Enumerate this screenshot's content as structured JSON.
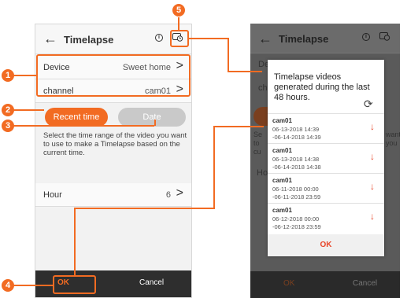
{
  "left_screen": {
    "title": "Timelapse",
    "back_icon": "←",
    "info_icon": "i",
    "device_label": "Device",
    "device_value": "Sweet home",
    "channel_label": "channel",
    "channel_value": "cam01",
    "chevron": ">",
    "recent_time_button": "Recent time",
    "date_button": "Date",
    "description": "Select the time range of the video you want to use to make a Timelapse based on the current time.",
    "hour_label": "Hour",
    "hour_value": "6",
    "ok_label": "OK",
    "cancel_label": "Cancel"
  },
  "right_screen": {
    "title": "Timelapse",
    "back_icon": "←",
    "info_icon": "i",
    "ghost_labels": [
      "De",
      "ch",
      "Se",
      "to",
      "cu",
      "Ho",
      "want",
      "you"
    ],
    "ok_label": "OK",
    "cancel_label": "Cancel",
    "dialog": {
      "title": "Timelapse videos generated during the last 48 hours.",
      "refresh_icon": "⟳",
      "videos": [
        {
          "name": "cam01",
          "start": "06-13-2018 14:39",
          "end": "-06-14-2018 14:39"
        },
        {
          "name": "cam01",
          "start": "06-13-2018 14:38",
          "end": "-06-14-2018 14:38"
        },
        {
          "name": "cam01",
          "start": "06-11-2018 00:00",
          "end": "-06-11-2018 23:59"
        },
        {
          "name": "cam01",
          "start": "06-12-2018 00:00",
          "end": "-06-12-2018 23:59"
        }
      ],
      "download_icon": "↓",
      "ok_label": "OK"
    }
  },
  "callouts": [
    "1",
    "2",
    "3",
    "4",
    "5"
  ],
  "colors": {
    "accent": "#f26b22",
    "download": "#e8472b",
    "dark_bar": "#2e2e2e"
  }
}
